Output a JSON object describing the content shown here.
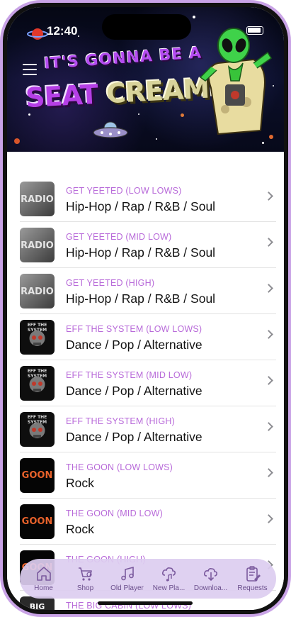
{
  "status": {
    "time": "12:40"
  },
  "banner": {
    "line1": "IT'S GONNA BE A",
    "line2a": "SEAT",
    "line2b": "CREAMER"
  },
  "rows": [
    {
      "subtitle": "GET YEETED (LOW LOWS)",
      "title": "Hip-Hop / Rap / R&B / Soul",
      "thumb": "RADIO"
    },
    {
      "subtitle": "GET YEETED (MID LOW)",
      "title": "Hip-Hop / Rap / R&B / Soul",
      "thumb": "RADIO"
    },
    {
      "subtitle": "GET YEETED (HIGH)",
      "title": "Hip-Hop / Rap / R&B / Soul",
      "thumb": "RADIO"
    },
    {
      "subtitle": "EFF THE SYSTEM (LOW LOWS)",
      "title": "Dance / Pop / Alternative",
      "thumb": "EFF THE SYSTEM"
    },
    {
      "subtitle": "EFF THE SYSTEM (MID LOW)",
      "title": "Dance / Pop / Alternative",
      "thumb": "EFF THE SYSTEM"
    },
    {
      "subtitle": "EFF THE SYSTEM (HIGH)",
      "title": "Dance / Pop / Alternative",
      "thumb": "EFF THE SYSTEM"
    },
    {
      "subtitle": "THE GOON (LOW LOWS)",
      "title": "Rock",
      "thumb": "GOON"
    },
    {
      "subtitle": "THE GOON (MID LOW)",
      "title": "Rock",
      "thumb": "GOON"
    },
    {
      "subtitle": "THE GOON (HIGH)",
      "title": "",
      "thumb": "GOON"
    },
    {
      "subtitle": "THE BIG CABIN (LOW LOWS)",
      "title": "",
      "thumb": "BIG CABIN"
    }
  ],
  "tabs": [
    {
      "label": "Home",
      "icon": "home-icon"
    },
    {
      "label": "Shop",
      "icon": "cart-icon"
    },
    {
      "label": "Old Player",
      "icon": "music-notes-icon"
    },
    {
      "label": "New Pla...",
      "icon": "cloud-music-icon"
    },
    {
      "label": "Downloa...",
      "icon": "cloud-download-icon"
    },
    {
      "label": "Requests",
      "icon": "clipboard-edit-icon"
    }
  ],
  "colors": {
    "accent": "#b86ad9",
    "frame": "#c9a3e6",
    "tabbar": "#dccdf0"
  }
}
